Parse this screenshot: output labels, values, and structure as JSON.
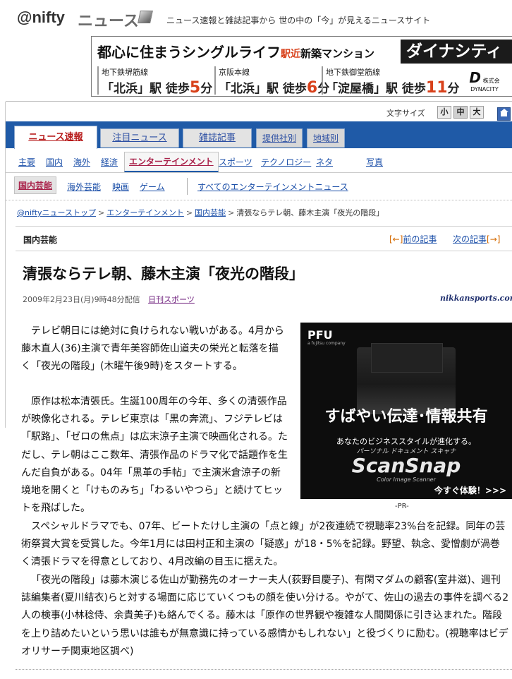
{
  "header": {
    "logo": "@nifty",
    "section_logo": "ニュース",
    "tagline": "ニュース速報と雑誌記事から 世の中の「今」が見えるニュースサイト"
  },
  "banner": {
    "headline": "都心に住まうシングルライフ",
    "headline_red": "駅近",
    "headline_tail": "新築マンション",
    "brand": "ダイナシティ",
    "stations": [
      {
        "line": "地下鉄堺筋線",
        "name": "「北浜」駅 徒歩",
        "min": "5",
        "unit": "分"
      },
      {
        "line": "京阪本線",
        "name": "「北浜」駅 徒歩",
        "min": "6",
        "unit": "分"
      },
      {
        "line": "地下鉄御堂筋線",
        "name": "「淀屋橋」駅 徒歩",
        "min": "11",
        "unit": "分"
      }
    ],
    "company_mark": "D",
    "company": "DYNACITY",
    "company_prefix": "株式会"
  },
  "font_size": {
    "label": "文字サイズ",
    "small": "小",
    "medium": "中",
    "large": "大"
  },
  "tabs": [
    {
      "label": "ニュース速報"
    },
    {
      "label": "注目ニュース"
    },
    {
      "label": "雑誌記事"
    },
    {
      "label": "提供社別"
    },
    {
      "label": "地域別"
    }
  ],
  "categories": [
    "主要",
    "国内",
    "海外",
    "経済",
    "エンターテインメント",
    "スポーツ",
    "テクノロジー",
    "ネタ",
    "写真"
  ],
  "subcategories": [
    "国内芸能",
    "海外芸能",
    "映画",
    "ゲーム"
  ],
  "subcategories_all": "すべてのエンターテインメントニュース",
  "breadcrumb": {
    "items": [
      "@niftyニューストップ",
      "エンターテインメント",
      "国内芸能"
    ],
    "current": "清張ならテレ朝、藤木主演「夜光の階段」",
    "sep": ">"
  },
  "section_label": "国内芸能",
  "pager": {
    "prev": "前の記事",
    "next": "次の記事",
    "prev_bracket": "[←]",
    "next_bracket": "[→]"
  },
  "article": {
    "title": "清張ならテレ朝、藤木主演「夜光の階段」",
    "date": "2009年2月23日(月)9時48分配信",
    "source": "日刊スポーツ",
    "source_logo": "nikkansports.com",
    "p1": "テレビ朝日には絶対に負けられない戦いがある。4月から藤木直人(36)主演で青年美容師佐山道夫の栄光と転落を描く「夜光の階段」(木曜午後9時)をスタートする。",
    "p2": "原作は松本清張氏。生誕100周年の今年、多くの清張作品が映像化される。テレビ東京は「黒の奔流」、フジテレビは「駅路」、「ゼロの焦点」は広末涼子主演で映画化される。ただし、テレ朝はここ数年、清張作品のドラマ化で話題作を生んだ自負がある。04年「黒革の手帖」で主演米倉涼子の新境地を開くと「けものみち」「わるいやつら」と続けてヒットを飛ばした。",
    "p3": "スペシャルドラマでも、07年、ビートたけし主演の「点と線」が2夜連続で視聴率23%台を記録。同年の芸術祭賞大賞を受賞した。今年1月には田村正和主演の「疑惑」が18・5%を記録。野望、執念、愛憎劇が渦巻く清張ドラマを得意としており、4月改編の目玉に据えた。",
    "p4": "「夜光の階段」は藤木演じる佐山が勤務先のオーナー夫人(荻野目慶子)、有閑マダムの顧客(室井滋)、週刊誌編集者(夏川結衣)らと対する場面に応じていくつもの顔を使い分ける。やがて、佐山の過去の事件を調べる2人の検事(小林稔侍、余貴美子)も絡んでくる。藤木は「原作の世界観や複雑な人間関係に引き込まれた。階段を上り詰めたいという思いは誰もが無意識に持っている感情かもしれない」と役づくりに励む。(視聴率はビデオリサーチ関東地区調べ)"
  },
  "ad": {
    "logo": "PFU",
    "logo_sub": "a fujitsu company",
    "headline": "すばやい伝達･情報共有",
    "line2": "あなたのビジネススタイルが進化する。",
    "line3": "パーソナル ドキュメント スキャナ",
    "brand": "ScanSnap",
    "brand_sub": "Color Image Scanner",
    "cta": "今すぐ体験！>>>",
    "pr_label": "-PR-"
  }
}
